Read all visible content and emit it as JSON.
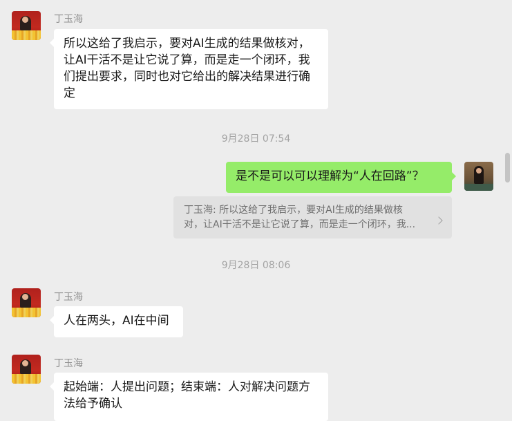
{
  "messages": [
    {
      "sender": "丁玉海",
      "lines": [
        "所以这给了我启示，要对AI生成的结果做核对，",
        "让AI干活不是让它说了算，而是走一个闭环，我",
        "们提出要求，同时也对它给出的解决结果进行确",
        "定"
      ]
    },
    {
      "timestamp": "9月28日 07:54"
    },
    {
      "text": "是不是可以可以理解为“人在回路”？",
      "quote_lines": [
        "丁玉海: 所以这给了我启示，要对AI生成的结果做核",
        "对，让AI干活不是让它说了算，而是走一个闭环，我..."
      ]
    },
    {
      "timestamp": "9月28日 08:06"
    },
    {
      "sender": "丁玉海",
      "text": "人在两头，AI在中间"
    },
    {
      "sender": "丁玉海",
      "lines": [
        "起始端：人提出问题；结束端：人对解决问题方",
        "法给予确认"
      ]
    }
  ]
}
